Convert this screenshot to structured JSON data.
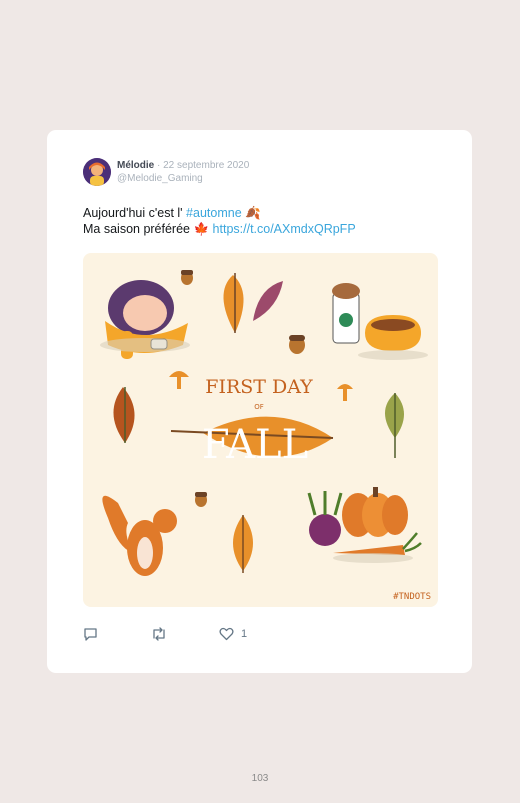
{
  "tweet": {
    "author_name": "Mélodie",
    "date": "· 22 septembre 2020",
    "handle": "@Melodie_Gaming",
    "line1_text": "Aujourd'hui c'est l' ",
    "line1_hashtag": "#automne",
    "line1_emoji": "🍂",
    "line2_text": "Ma saison préférée ",
    "line2_emoji": "🍁",
    "line2_link": "https://t.co/AXmdxQRpFP",
    "like_count": "1"
  },
  "media": {
    "headline_top": "FIRST DAY",
    "headline_of": "OF",
    "headline_main": "FALL",
    "signature": "#TNDOTS"
  },
  "icons": [
    "reply-icon",
    "retweet-icon",
    "like-icon"
  ],
  "colors": {
    "background": "#efe8e6",
    "link": "#3aa6dc",
    "illustration_orange": "#e8902a"
  },
  "page_number": "103"
}
